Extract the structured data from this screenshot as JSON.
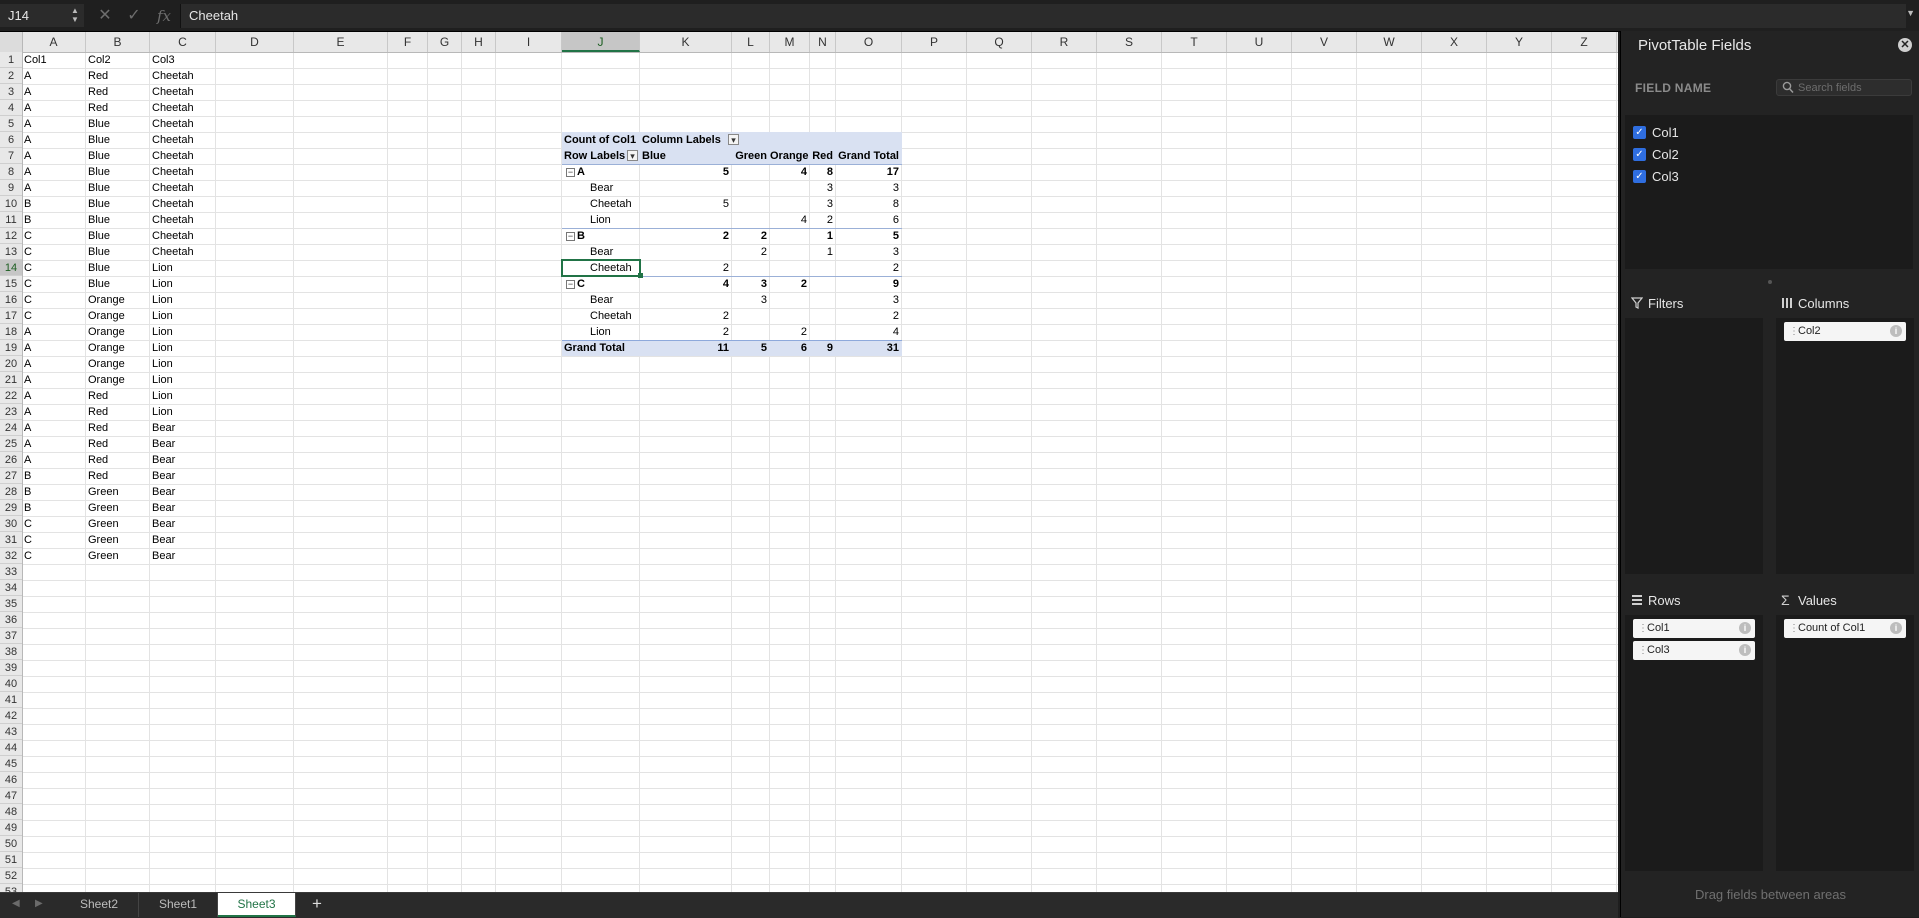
{
  "formula": {
    "cell_ref": "J14",
    "content": "Cheetah",
    "cancel_icon": "✕",
    "enter_icon": "✓",
    "fx_label": "fx"
  },
  "columns": [
    {
      "label": "A",
      "w": 64
    },
    {
      "label": "B",
      "w": 64
    },
    {
      "label": "C",
      "w": 66
    },
    {
      "label": "D",
      "w": 78
    },
    {
      "label": "E",
      "w": 94
    },
    {
      "label": "F",
      "w": 40
    },
    {
      "label": "G",
      "w": 34
    },
    {
      "label": "H",
      "w": 34
    },
    {
      "label": "I",
      "w": 66
    },
    {
      "label": "J",
      "w": 78
    },
    {
      "label": "K",
      "w": 92
    },
    {
      "label": "L",
      "w": 38
    },
    {
      "label": "M",
      "w": 40
    },
    {
      "label": "N",
      "w": 26
    },
    {
      "label": "O",
      "w": 66
    },
    {
      "label": "P",
      "w": 65
    },
    {
      "label": "Q",
      "w": 65
    },
    {
      "label": "R",
      "w": 65
    },
    {
      "label": "S",
      "w": 65
    },
    {
      "label": "T",
      "w": 65
    },
    {
      "label": "U",
      "w": 65
    },
    {
      "label": "V",
      "w": 65
    },
    {
      "label": "W",
      "w": 65
    },
    {
      "label": "X",
      "w": 65
    },
    {
      "label": "Y",
      "w": 65
    },
    {
      "label": "Z",
      "w": 65
    }
  ],
  "selected_column": "J",
  "selected_row": 14,
  "row_count": 53,
  "source_data": [
    [
      "Col1",
      "Col2",
      "Col3"
    ],
    [
      "A",
      "Red",
      "Cheetah"
    ],
    [
      "A",
      "Red",
      "Cheetah"
    ],
    [
      "A",
      "Red",
      "Cheetah"
    ],
    [
      "A",
      "Blue",
      "Cheetah"
    ],
    [
      "A",
      "Blue",
      "Cheetah"
    ],
    [
      "A",
      "Blue",
      "Cheetah"
    ],
    [
      "A",
      "Blue",
      "Cheetah"
    ],
    [
      "A",
      "Blue",
      "Cheetah"
    ],
    [
      "B",
      "Blue",
      "Cheetah"
    ],
    [
      "B",
      "Blue",
      "Cheetah"
    ],
    [
      "C",
      "Blue",
      "Cheetah"
    ],
    [
      "C",
      "Blue",
      "Cheetah"
    ],
    [
      "C",
      "Blue",
      "Lion"
    ],
    [
      "C",
      "Blue",
      "Lion"
    ],
    [
      "C",
      "Orange",
      "Lion"
    ],
    [
      "C",
      "Orange",
      "Lion"
    ],
    [
      "A",
      "Orange",
      "Lion"
    ],
    [
      "A",
      "Orange",
      "Lion"
    ],
    [
      "A",
      "Orange",
      "Lion"
    ],
    [
      "A",
      "Orange",
      "Lion"
    ],
    [
      "A",
      "Red",
      "Lion"
    ],
    [
      "A",
      "Red",
      "Lion"
    ],
    [
      "A",
      "Red",
      "Bear"
    ],
    [
      "A",
      "Red",
      "Bear"
    ],
    [
      "A",
      "Red",
      "Bear"
    ],
    [
      "B",
      "Red",
      "Bear"
    ],
    [
      "B",
      "Green",
      "Bear"
    ],
    [
      "B",
      "Green",
      "Bear"
    ],
    [
      "C",
      "Green",
      "Bear"
    ],
    [
      "C",
      "Green",
      "Bear"
    ],
    [
      "C",
      "Green",
      "Bear"
    ]
  ],
  "pivot": {
    "header_row1": {
      "label": "Count of Col1",
      "col_labels": "Column Labels"
    },
    "header_row2": {
      "row_labels": "Row Labels",
      "cols": [
        "Blue",
        "Green",
        "Orange",
        "Red",
        "Grand Total"
      ]
    },
    "rows": [
      {
        "label": "A",
        "level": 0,
        "values": [
          "5",
          "",
          "4",
          "8",
          "17"
        ]
      },
      {
        "label": "Bear",
        "level": 1,
        "values": [
          "",
          "",
          "",
          "3",
          "3"
        ]
      },
      {
        "label": "Cheetah",
        "level": 1,
        "values": [
          "5",
          "",
          "",
          "3",
          "8"
        ]
      },
      {
        "label": "Lion",
        "level": 1,
        "values": [
          "",
          "",
          "4",
          "2",
          "6"
        ]
      },
      {
        "label": "B",
        "level": 0,
        "values": [
          "2",
          "2",
          "",
          "1",
          "5"
        ]
      },
      {
        "label": "Bear",
        "level": 1,
        "values": [
          "",
          "2",
          "",
          "1",
          "3"
        ]
      },
      {
        "label": "Cheetah",
        "level": 1,
        "values": [
          "2",
          "",
          "",
          "",
          "2"
        ]
      },
      {
        "label": "C",
        "level": 0,
        "values": [
          "4",
          "3",
          "2",
          "",
          "9"
        ]
      },
      {
        "label": "Bear",
        "level": 1,
        "values": [
          "",
          "3",
          "",
          "",
          "3"
        ]
      },
      {
        "label": "Cheetah",
        "level": 1,
        "values": [
          "2",
          "",
          "",
          "",
          "2"
        ]
      },
      {
        "label": "Lion",
        "level": 1,
        "values": [
          "2",
          "",
          "2",
          "",
          "4"
        ]
      }
    ],
    "grand_total": {
      "label": "Grand Total",
      "values": [
        "11",
        "5",
        "6",
        "9",
        "31"
      ]
    },
    "collapse_glyph": "−",
    "filter_glyph": "▾"
  },
  "tabs": {
    "sheets": [
      "Sheet2",
      "Sheet1",
      "Sheet3"
    ],
    "active": "Sheet3",
    "add_label": "+",
    "prev_icon": "◀",
    "next_icon": "▶"
  },
  "pane": {
    "title": "PivotTable Fields",
    "close_glyph": "✕",
    "field_name_label": "FIELD NAME",
    "search_placeholder": "Search fields",
    "fields": [
      "Col1",
      "Col2",
      "Col3"
    ],
    "check_glyph": "✓",
    "filters_title": "Filters",
    "columns_title": "Columns",
    "rows_title": "Rows",
    "values_title": "Values",
    "columns_items": [
      "Col2"
    ],
    "rows_items": [
      "Col1",
      "Col3"
    ],
    "values_items": [
      "Count of Col1"
    ],
    "grip_glyph": "⋮",
    "info_glyph": "i",
    "drag_hint": "Drag fields between areas"
  },
  "colors": {
    "accent": "#217346",
    "pivot_header": "#d9e1f2",
    "checkbox": "#2f6ee0"
  }
}
